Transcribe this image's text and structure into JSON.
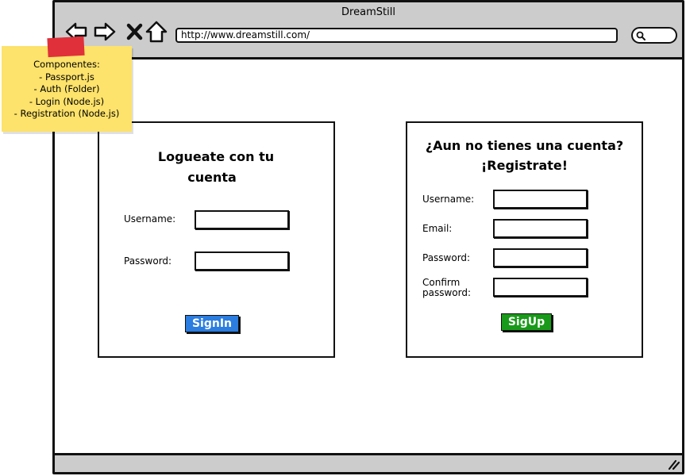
{
  "window": {
    "title": "DreamStill",
    "url": "http://www.dreamstill.com/"
  },
  "nav": {
    "back_icon": "back-arrow-icon",
    "forward_icon": "forward-arrow-icon",
    "stop_icon": "close-icon",
    "home_icon": "home-icon",
    "search_icon": "search-icon"
  },
  "note": {
    "line1": "Componentes:",
    "line2": "- Passport.js",
    "line3": "- Auth (Folder)",
    "line4": "- Login (Node.js)",
    "line5": "- Registration (Node.js)"
  },
  "login": {
    "heading_line1": "Logueate con tu",
    "heading_line2": "cuenta",
    "username_label": "Username:",
    "password_label": "Password:",
    "button": "SignIn"
  },
  "register": {
    "heading_line1": "¿Aun no tienes una cuenta?",
    "heading_line2": "¡Registrate!",
    "username_label": "Username:",
    "email_label": "Email:",
    "password_label": "Password:",
    "confirm_label_line1": "Confirm",
    "confirm_label_line2": "password:",
    "button": "SigUp"
  },
  "colors": {
    "chrome": "#cccccc",
    "signin_button": "#2b7de0",
    "signup_button": "#1a9a1a",
    "sticky_note": "#fde26b",
    "sticky_tape": "#e0303a"
  }
}
